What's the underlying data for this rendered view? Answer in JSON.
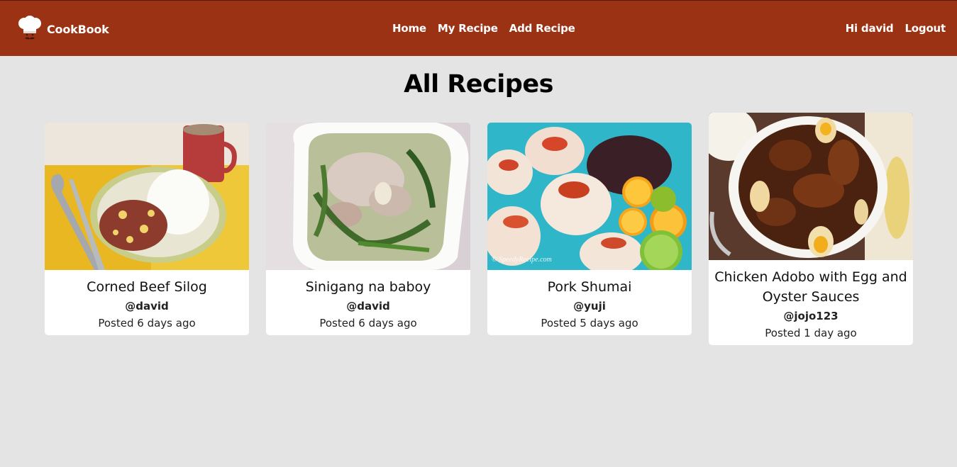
{
  "app": {
    "name": "CookBook"
  },
  "nav": {
    "links": [
      "Home",
      "My Recipe",
      "Add Recipe"
    ],
    "greeting": "Hi david",
    "logout": "Logout"
  },
  "page": {
    "title": "All Recipes"
  },
  "recipes": [
    {
      "title": "Corned Beef Silog",
      "author": "@david",
      "posted": "Posted 6 days ago",
      "image": "corned-beef-silog-photo"
    },
    {
      "title": "Sinigang na baboy",
      "author": "@david",
      "posted": "Posted 6 days ago",
      "image": "sinigang-photo"
    },
    {
      "title": "Pork Shumai",
      "author": "@yuji",
      "posted": "Posted 5 days ago",
      "image": "pork-shumai-photo",
      "watermark": "© SpeedyRecipe.com"
    },
    {
      "title": "Chicken Adobo with Egg and Oyster Sauces",
      "author": "@jojo123",
      "posted": "Posted 1 day ago",
      "image": "chicken-adobo-photo"
    }
  ],
  "colors": {
    "navbar": "#9c3214",
    "background": "#e4e4e4",
    "card": "#ffffff"
  }
}
